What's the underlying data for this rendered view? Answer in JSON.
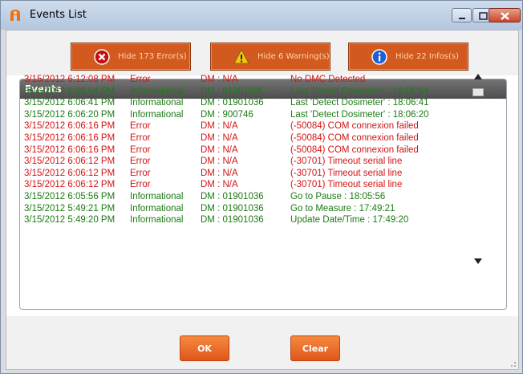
{
  "window": {
    "title": "Events List",
    "controls": [
      "minimize-icon",
      "maximize-icon",
      "close-icon"
    ]
  },
  "filters": [
    {
      "name": "hide-errors-button",
      "icon": "error-circle-icon",
      "label": "Hide 173 Error(s)"
    },
    {
      "name": "hide-warnings-button",
      "icon": "warning-triangle-icon",
      "label": "Hide 6 Warning(s)"
    },
    {
      "name": "hide-infos-button",
      "icon": "info-circle-icon",
      "label": "Hide 22 Infos(s)"
    }
  ],
  "panel": {
    "title": "Events"
  },
  "colors": {
    "error": "#d21414",
    "info": "#1d7a14",
    "button": "#d25a1f"
  },
  "events": [
    {
      "date": "3/15/2012 6:12:08 PM",
      "type": "Error",
      "dm": "DM : N/A",
      "message": "No DMC Detected",
      "level": "error"
    },
    {
      "date": "3/15/2012 6:06:54 PM",
      "type": "Informational",
      "dm": "DM : 01901036",
      "message": "Last 'Detect Dosimeter' : 18:06:54",
      "level": "info"
    },
    {
      "date": "3/15/2012 6:06:41 PM",
      "type": "Informational",
      "dm": "DM : 01901036",
      "message": "Last 'Detect Dosimeter' : 18:06:41",
      "level": "info"
    },
    {
      "date": "3/15/2012 6:06:20 PM",
      "type": "Informational",
      "dm": "DM : 900746",
      "message": "Last 'Detect Dosimeter' : 18:06:20",
      "level": "info"
    },
    {
      "date": "3/15/2012 6:06:16 PM",
      "type": "Error",
      "dm": "DM : N/A",
      "message": "(-50084) COM connexion failed",
      "level": "error"
    },
    {
      "date": "3/15/2012 6:06:16 PM",
      "type": "Error",
      "dm": "DM : N/A",
      "message": "(-50084) COM connexion failed",
      "level": "error"
    },
    {
      "date": "3/15/2012 6:06:16 PM",
      "type": "Error",
      "dm": "DM : N/A",
      "message": "(-50084) COM connexion failed",
      "level": "error"
    },
    {
      "date": "3/15/2012 6:06:12 PM",
      "type": "Error",
      "dm": "DM : N/A",
      "message": "(-30701) Timeout serial line",
      "level": "error"
    },
    {
      "date": "3/15/2012 6:06:12 PM",
      "type": "Error",
      "dm": "DM : N/A",
      "message": "(-30701) Timeout serial line",
      "level": "error"
    },
    {
      "date": "3/15/2012 6:06:12 PM",
      "type": "Error",
      "dm": "DM : N/A",
      "message": "(-30701) Timeout serial line",
      "level": "error"
    },
    {
      "date": "3/15/2012 6:05:56 PM",
      "type": "Informational",
      "dm": "DM : 01901036",
      "message": "Go to Pause : 18:05:56",
      "level": "info"
    },
    {
      "date": "3/15/2012 5:49:21 PM",
      "type": "Informational",
      "dm": "DM : 01901036",
      "message": "Go to Measure : 17:49:21",
      "level": "info"
    },
    {
      "date": "3/15/2012 5:49:20 PM",
      "type": "Informational",
      "dm": "DM : 01901036",
      "message": "Update Date/Time : 17:49:20",
      "level": "info"
    }
  ],
  "footer": {
    "ok_label": "OK",
    "clear_label": "Clear"
  }
}
